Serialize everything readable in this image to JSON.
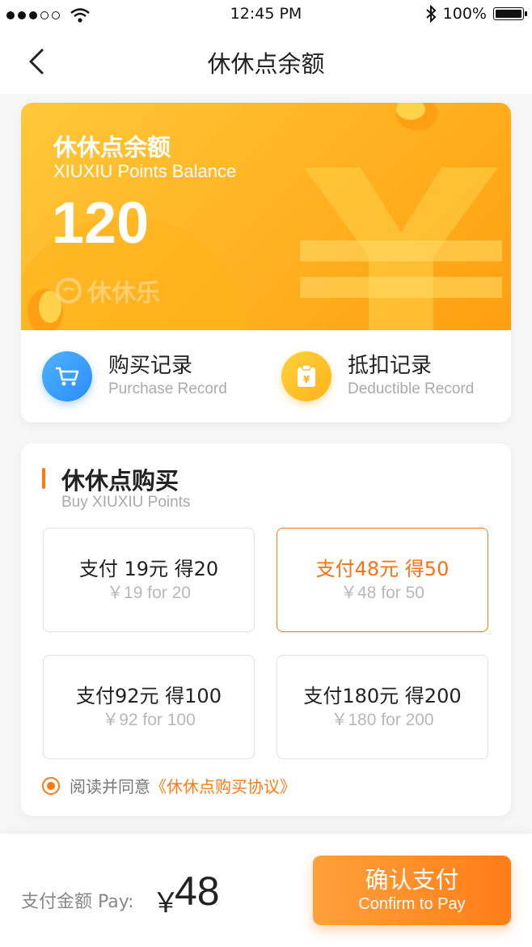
{
  "status_bar": {
    "time": "12:45 PM",
    "battery": "100%"
  },
  "nav": {
    "title": "休休点余额",
    "back_icon": "chevron-left-icon"
  },
  "balance": {
    "title": "休休点余额",
    "subtitle": "XIUXIU Points Balance",
    "amount": "120",
    "logo_text": "休休乐",
    "colors": {
      "from": "#ffc83a",
      "to": "#ff9f12"
    }
  },
  "records": {
    "purchase": {
      "title": "购买记录",
      "subtitle": "Purchase Record",
      "icon": "cart-icon"
    },
    "deduct": {
      "title": "抵扣记录",
      "subtitle": "Deductible Record",
      "icon": "voucher-icon"
    }
  },
  "buy": {
    "title": "休休点购买",
    "subtitle": "Buy XIUXIU Points",
    "options": [
      {
        "main": "支付 19元 得20",
        "sub": "￥19 for 20",
        "selected": false
      },
      {
        "main": "支付48元 得50",
        "sub": "￥48 for 50",
        "selected": true
      },
      {
        "main": "支付92元 得100",
        "sub": "￥92 for 100",
        "selected": false
      },
      {
        "main": "支付180元 得200",
        "sub": "￥180 for 200",
        "selected": false
      }
    ],
    "agreement": {
      "prefix": "阅读并同意",
      "link": "《休休点购买协议》",
      "checked": true
    }
  },
  "footer": {
    "pay_label": "支付金额 Pay:",
    "currency": "￥",
    "amount": "48",
    "confirm_main": "确认支付",
    "confirm_sub": "Confirm to Pay"
  },
  "accent_color": "#ff7a12"
}
